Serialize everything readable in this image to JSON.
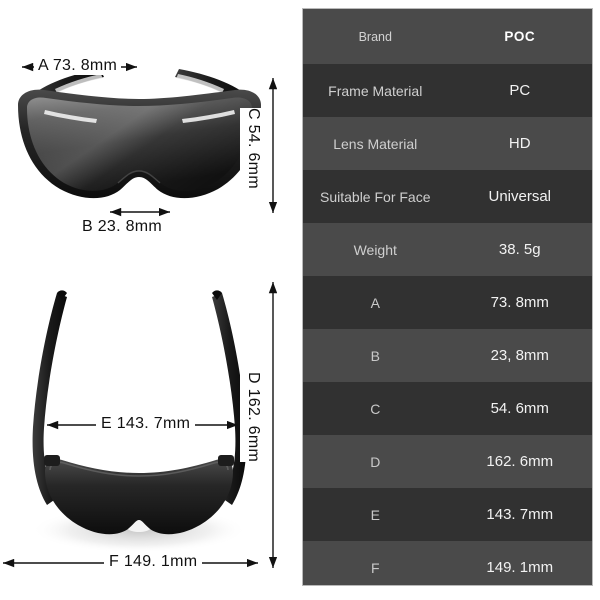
{
  "product": {
    "type": "sunglasses",
    "views": [
      "front-view",
      "top-down-view"
    ]
  },
  "diagram": {
    "front_view": {
      "name": "front-view",
      "labels": [
        {
          "id": "A",
          "text": "A  73. 8mm",
          "axis": "horizontal",
          "desc": "lens-width"
        },
        {
          "id": "B",
          "text": "B  23. 8mm",
          "axis": "horizontal",
          "desc": "bridge-width"
        },
        {
          "id": "C",
          "text": "C  54. 6mm",
          "axis": "vertical",
          "desc": "lens-height"
        }
      ]
    },
    "top_view": {
      "name": "top-down-view",
      "labels": [
        {
          "id": "D",
          "text": "D  162. 6mm",
          "axis": "vertical",
          "desc": "temple-length"
        },
        {
          "id": "E",
          "text": "E  143. 7mm",
          "axis": "horizontal",
          "desc": "inner-frame-width"
        },
        {
          "id": "F",
          "text": "F  149. 1mm",
          "axis": "horizontal",
          "desc": "total-frame-width"
        }
      ]
    }
  },
  "spec_table": {
    "rows": [
      {
        "key": "Brand",
        "value": "POC",
        "style": "brand",
        "band": "light"
      },
      {
        "key": "Frame Material",
        "value": "PC",
        "style": "text",
        "band": "dark"
      },
      {
        "key": "Lens Material",
        "value": "HD",
        "style": "text",
        "band": "light"
      },
      {
        "key": "Suitable For Face",
        "value": "Universal",
        "style": "text",
        "band": "dark"
      },
      {
        "key": "Weight",
        "value": "38. 5g",
        "style": "text",
        "band": "light"
      },
      {
        "key": "A",
        "value": "73. 8mm",
        "style": "letter",
        "band": "dark"
      },
      {
        "key": "B",
        "value": "23, 8mm",
        "style": "letter",
        "band": "light"
      },
      {
        "key": "C",
        "value": "54. 6mm",
        "style": "letter",
        "band": "dark"
      },
      {
        "key": "D",
        "value": "162. 6mm",
        "style": "letter",
        "band": "light"
      },
      {
        "key": "E",
        "value": "143. 7mm",
        "style": "letter",
        "band": "dark"
      },
      {
        "key": "F",
        "value": "149. 1mm",
        "style": "letter",
        "band": "light"
      }
    ]
  },
  "colors": {
    "page_background": "#ffffff",
    "row_dark": "#313131",
    "row_light": "#4a4a4a",
    "table_border": "#b9b9b9",
    "key_text": "#cfcfcf",
    "value_text": "#f2f2f2",
    "brand_value_text": "#ffffff",
    "dimension_line": "#111111",
    "frame_black": "#1b1b1b",
    "lens_grey": "#6d6d6d"
  }
}
